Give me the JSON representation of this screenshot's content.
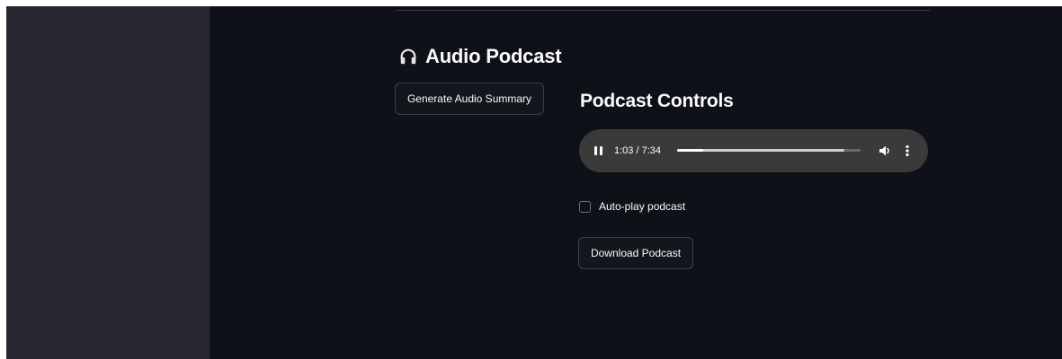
{
  "sidebar": {},
  "section": {
    "title": "Audio Podcast",
    "icon": "headphones-icon"
  },
  "buttons": {
    "generate_label": "Generate Audio Summary",
    "download_label": "Download Podcast"
  },
  "podcast_controls": {
    "title": "Podcast Controls",
    "player": {
      "state": "playing",
      "time_display": "1:03 / 7:34",
      "played_fraction": 0.14,
      "buffered_fraction": 0.91
    },
    "autoplay": {
      "label": "Auto-play podcast",
      "checked": false
    }
  },
  "colors": {
    "background": "#0e1117",
    "sidebar": "#262730",
    "text": "#fafafa",
    "player": "#3a3a3a"
  }
}
